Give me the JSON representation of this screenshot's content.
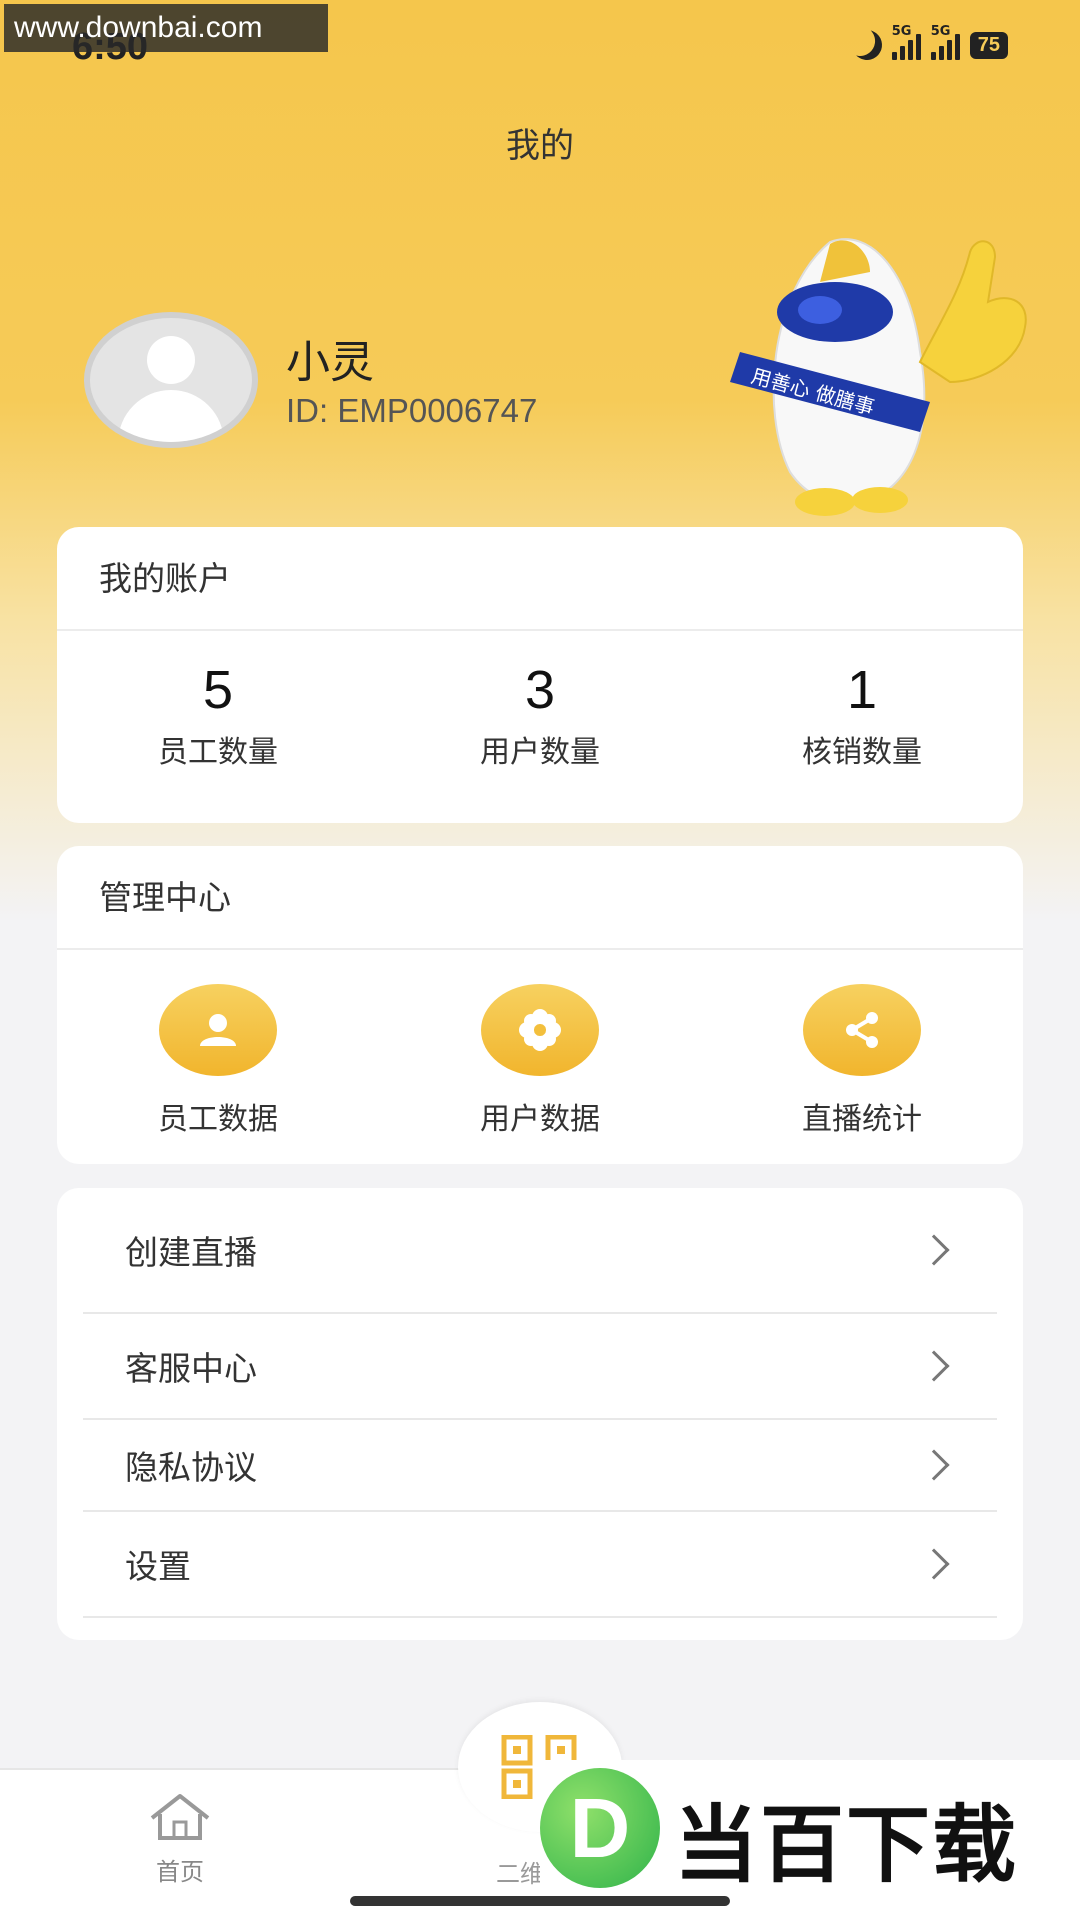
{
  "watermark": "www.downbai.com",
  "status_bar": {
    "time": "6:50",
    "battery": "75",
    "signal_labels": [
      "5G",
      "5G"
    ]
  },
  "page_title": "我的",
  "profile": {
    "name": "小灵",
    "id_text": "ID: EMP0006747"
  },
  "mascot": {
    "sash_text": "用善心 做膳事"
  },
  "account": {
    "title": "我的账户",
    "stats": [
      {
        "value": "5",
        "label": "员工数量"
      },
      {
        "value": "3",
        "label": "用户数量"
      },
      {
        "value": "1",
        "label": "核销数量"
      }
    ]
  },
  "management": {
    "title": "管理中心",
    "items": [
      {
        "label": "员工数据",
        "icon": "person-icon"
      },
      {
        "label": "用户数据",
        "icon": "flower-icon"
      },
      {
        "label": "直播统计",
        "icon": "share-icon"
      }
    ]
  },
  "menu": [
    {
      "label": "创建直播"
    },
    {
      "label": "客服中心"
    },
    {
      "label": "隐私协议"
    },
    {
      "label": "设置"
    }
  ],
  "tabbar": {
    "home_label": "首页",
    "center_label": "二维"
  },
  "brand_overlay": {
    "logo_letter": "D",
    "text": "当百下载"
  },
  "colors": {
    "accent": "#f5c64c",
    "icon_gradient_top": "#f7d160",
    "icon_gradient_bottom": "#f1b52d"
  }
}
